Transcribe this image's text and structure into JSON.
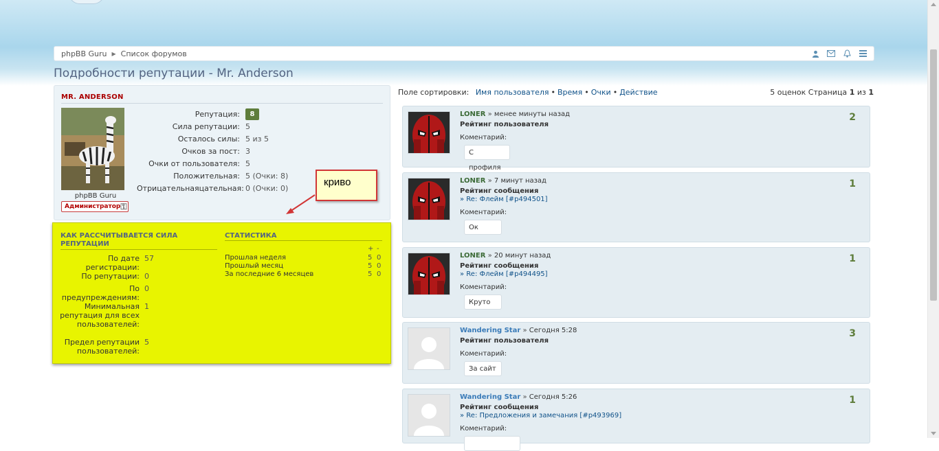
{
  "breadcrumb": {
    "home": "phpBB Guru",
    "forums": "Список форумов"
  },
  "page": {
    "title": "Подробности репутации - Mr. Anderson"
  },
  "profile": {
    "name": "MR. ANDERSON",
    "avatar_caption": "phpBB Guru",
    "rank_badge": "Администратор",
    "stats": [
      {
        "label": "Репутация:",
        "value": "8",
        "badge": true
      },
      {
        "label": "Сила репутации:",
        "value": "5"
      },
      {
        "label": "Осталось силы:",
        "value": "5 из 5"
      },
      {
        "label": "Очков за пост:",
        "value": "3"
      },
      {
        "label": "Очки от пользователя:",
        "value": "5"
      },
      {
        "label": "Положительная:",
        "value": "5 (Очки: 8)"
      },
      {
        "label": "Отрицательнаяцательная:",
        "value": "0 (Очки: 0)"
      }
    ]
  },
  "annotation": {
    "text": "криво"
  },
  "calc": {
    "title": "КАК РАССЧИТЫВАЕТСЯ СИЛА РЕПУТАЦИИ",
    "rows": [
      {
        "label": "По дате регистрации:",
        "value": "57"
      },
      {
        "label": "По репутации:",
        "value": "0"
      },
      {
        "label": "По предупреждениям:",
        "value": "0"
      },
      {
        "label": "Минимальная репутация для всех пользователей:",
        "value": "1"
      },
      {
        "label": "Предел репутации пользователей:",
        "value": "5"
      }
    ]
  },
  "statistics": {
    "title": "СТАТИСТИКА",
    "plus": "+",
    "minus": "-",
    "rows": [
      {
        "label": "Прошлая неделя",
        "plus": "5",
        "minus": "0"
      },
      {
        "label": "Прошлый месяц",
        "plus": "5",
        "minus": "0"
      },
      {
        "label": "За последние 6 месяцев",
        "plus": "5",
        "minus": "0"
      }
    ]
  },
  "sort": {
    "label": "Поле сортировки:",
    "options": [
      "Имя пользователя",
      "Время",
      "Очки",
      "Действие"
    ],
    "count_text": "5 оценок Страница",
    "page": "1",
    "of": "из",
    "pages": "1"
  },
  "ratings": [
    {
      "user": "LONER",
      "time": "менее минуты назад",
      "type": "Рейтинг пользователя",
      "post": "",
      "comment_label": "Коментарий:",
      "comment": "С профиля",
      "score": "2"
    },
    {
      "user": "LONER",
      "time": "7 минут назад",
      "type": "Рейтинг сообщения",
      "post": "Re: Флейм [#p494501]",
      "comment_label": "Коментарий:",
      "comment": "Ок",
      "score": "1"
    },
    {
      "user": "LONER",
      "time": "20 минут назад",
      "type": "Рейтинг сообщения",
      "post": "Re: Флейм [#p494495]",
      "comment_label": "Коментарий:",
      "comment": "Круто",
      "score": "1"
    },
    {
      "user": "Wandering Star",
      "time": "Сегодня 5:28",
      "type": "Рейтинг пользователя",
      "post": "",
      "comment_label": "Коментарий:",
      "comment": "За сайт",
      "score": "3"
    },
    {
      "user": "Wandering Star",
      "time": "Сегодня 5:26",
      "type": "Рейтинг сообщения",
      "post": "Re: Предложения и замечания [#p493969]",
      "comment_label": "Коментарий:",
      "comment": "",
      "score": "1"
    }
  ],
  "colors": {
    "accent": "#105289",
    "score": "#5e7d3b",
    "highlight": "#e8f400",
    "name": "#aa0000"
  }
}
